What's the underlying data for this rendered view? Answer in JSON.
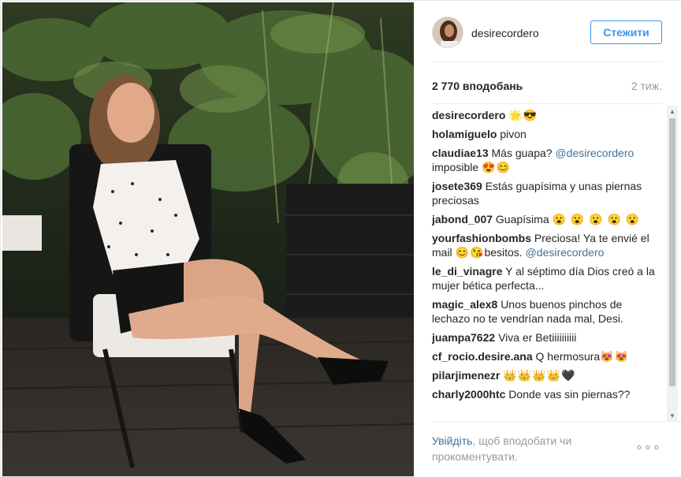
{
  "header": {
    "username": "desirecordero",
    "follow_label": "Стежити"
  },
  "stats": {
    "likes": "2 770 вподобань",
    "time": "2 тиж."
  },
  "comments": [
    {
      "user": "desirecordero",
      "parts": [
        {
          "type": "emoji",
          "text": "🌟😎"
        }
      ]
    },
    {
      "user": "holamiguelo",
      "parts": [
        {
          "type": "text",
          "text": "pivon"
        }
      ]
    },
    {
      "user": "claudiae13",
      "parts": [
        {
          "type": "text",
          "text": "Más guapa? "
        },
        {
          "type": "mention",
          "text": "@desirecordero"
        },
        {
          "type": "text",
          "text": " imposible "
        },
        {
          "type": "emoji",
          "text": "😍😊"
        }
      ]
    },
    {
      "user": "josete369",
      "parts": [
        {
          "type": "text",
          "text": "Estás guapísima y unas piernas preciosas"
        }
      ]
    },
    {
      "user": "jabond_007",
      "parts": [
        {
          "type": "text",
          "text": "Guapísima "
        },
        {
          "type": "emoji",
          "text": "😮 😮 😮 😮 😮"
        }
      ]
    },
    {
      "user": "yourfashionbombs",
      "parts": [
        {
          "type": "text",
          "text": "Preciosa! Ya te envié el mail "
        },
        {
          "type": "emoji",
          "text": "😊😘"
        },
        {
          "type": "text",
          "text": "besitos. "
        },
        {
          "type": "mention",
          "text": "@desirecordero"
        }
      ]
    },
    {
      "user": "le_di_vinagre",
      "parts": [
        {
          "type": "text",
          "text": "Y al séptimo día Dios creó a la mujer bética perfecta..."
        }
      ]
    },
    {
      "user": "magic_alex8",
      "parts": [
        {
          "type": "text",
          "text": "Unos buenos pinchos de lechazo no te vendrían nada mal, Desi."
        }
      ]
    },
    {
      "user": "juampa7622",
      "parts": [
        {
          "type": "text",
          "text": "Viva er Betiiiiiiiiii"
        }
      ]
    },
    {
      "user": "cf_rocio.desire.ana",
      "parts": [
        {
          "type": "text",
          "text": "Q hermosura"
        },
        {
          "type": "emoji",
          "text": "😻😻"
        }
      ]
    },
    {
      "user": "pilarjimenezr",
      "parts": [
        {
          "type": "emoji",
          "text": "👑👑👑👑🖤"
        }
      ]
    },
    {
      "user": "charly2000htc",
      "parts": [
        {
          "type": "text",
          "text": "Donde vas sin piernas??"
        }
      ]
    }
  ],
  "footer": {
    "login_link": "Увійдіть",
    "login_rest": ", щоб вподобати чи прокоментувати.",
    "more_label": "∘∘∘"
  },
  "scrollbar": {
    "up_arrow": "▲",
    "down_arrow": "▼"
  },
  "colors": {
    "accent": "#3897f0",
    "mention": "#3f729b",
    "muted": "#999999"
  }
}
